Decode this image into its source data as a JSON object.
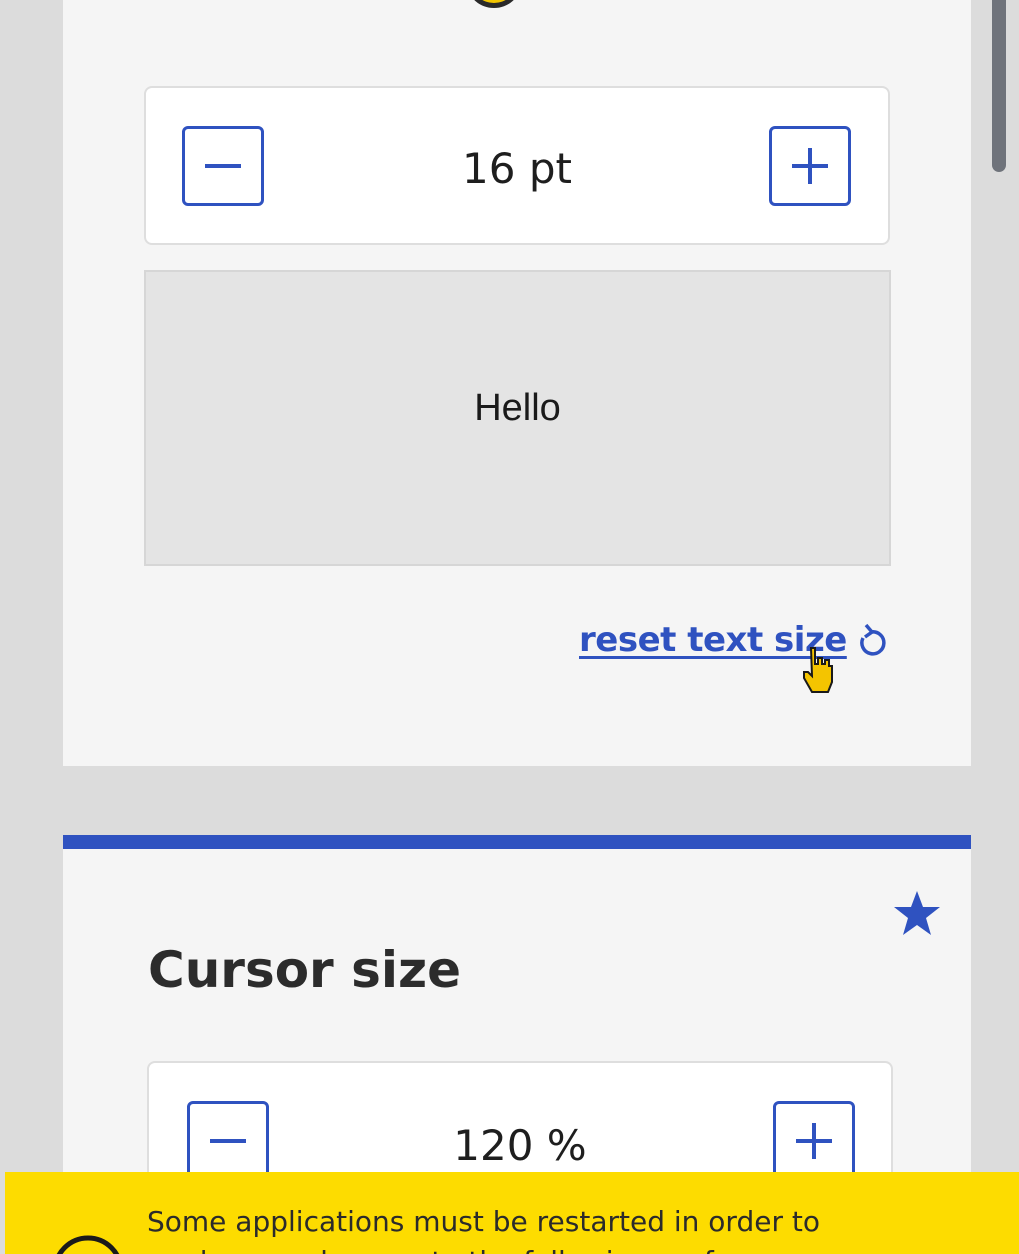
{
  "text_size": {
    "value": "16 pt",
    "decrease_icon": "minus-icon",
    "increase_icon": "plus-icon",
    "preview_text": "Hello",
    "reset_label": "reset text size",
    "reset_icon": "undo-icon"
  },
  "cursor_size": {
    "title": "Cursor size",
    "favorite_icon": "star-icon",
    "value": "120 %",
    "decrease_icon": "minus-icon",
    "increase_icon": "plus-icon"
  },
  "notice": {
    "text_line1": "Some applications must be restarted in order to",
    "text_line2": "apply your changes to the following preferences:",
    "icon": "info-icon"
  },
  "colors": {
    "accent": "#2f52c0",
    "notice_bg": "#fddc00",
    "card_bg": "#f5f5f5",
    "page_bg": "#dcdcdc"
  }
}
